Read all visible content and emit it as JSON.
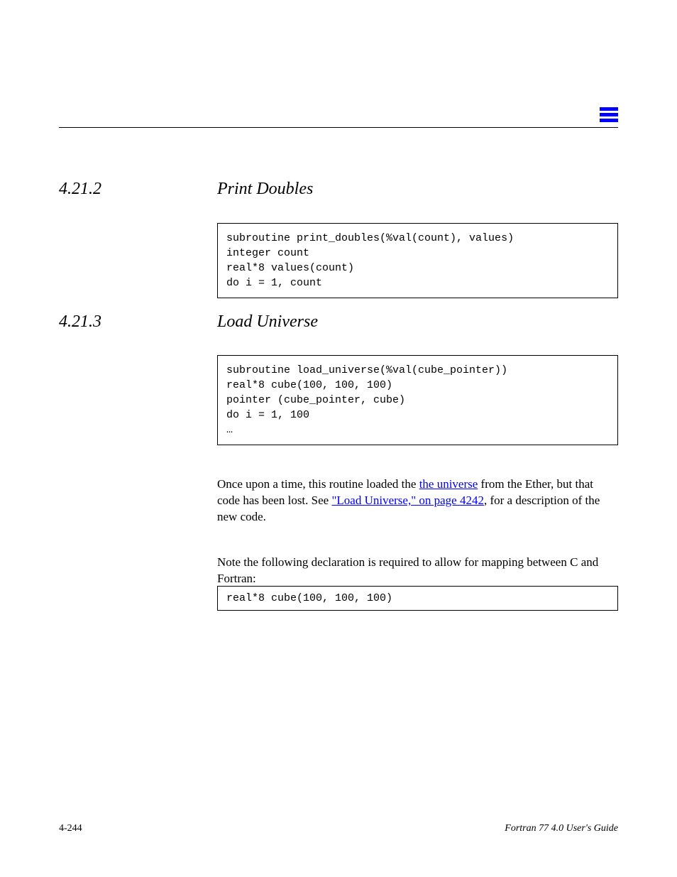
{
  "sections": {
    "print_doubles": {
      "number": "4.21.2",
      "title": "Print Doubles",
      "code": "subroutine print_doubles(%val(count), values)\ninteger count\nreal*8 values(count)\ndo i = 1, count"
    },
    "load_universe": {
      "number": "4.21.3",
      "title": "Load Universe",
      "code": "subroutine load_universe(%val(cube_pointer))\nreal*8 cube(100, 100, 100)\npointer (cube_pointer, cube)\ndo i = 1, 100\n…"
    }
  },
  "paragraph": {
    "pre": "Once upon a time, this routine loaded the ",
    "link1_text": "the universe",
    "mid1": " from the Ether, but that code has been lost. See ",
    "link2_text": "\"Load Universe,\" on page 4242",
    "mid2": ", for a description of the new code.",
    "note": "Note the following declaration is required to allow for mapping between C and Fortran:"
  },
  "required_box": {
    "code": "real*8 cube(100, 100, 100)"
  },
  "footer": {
    "left": "4-244",
    "right": "Fortran 77 4.0 User's Guide"
  }
}
